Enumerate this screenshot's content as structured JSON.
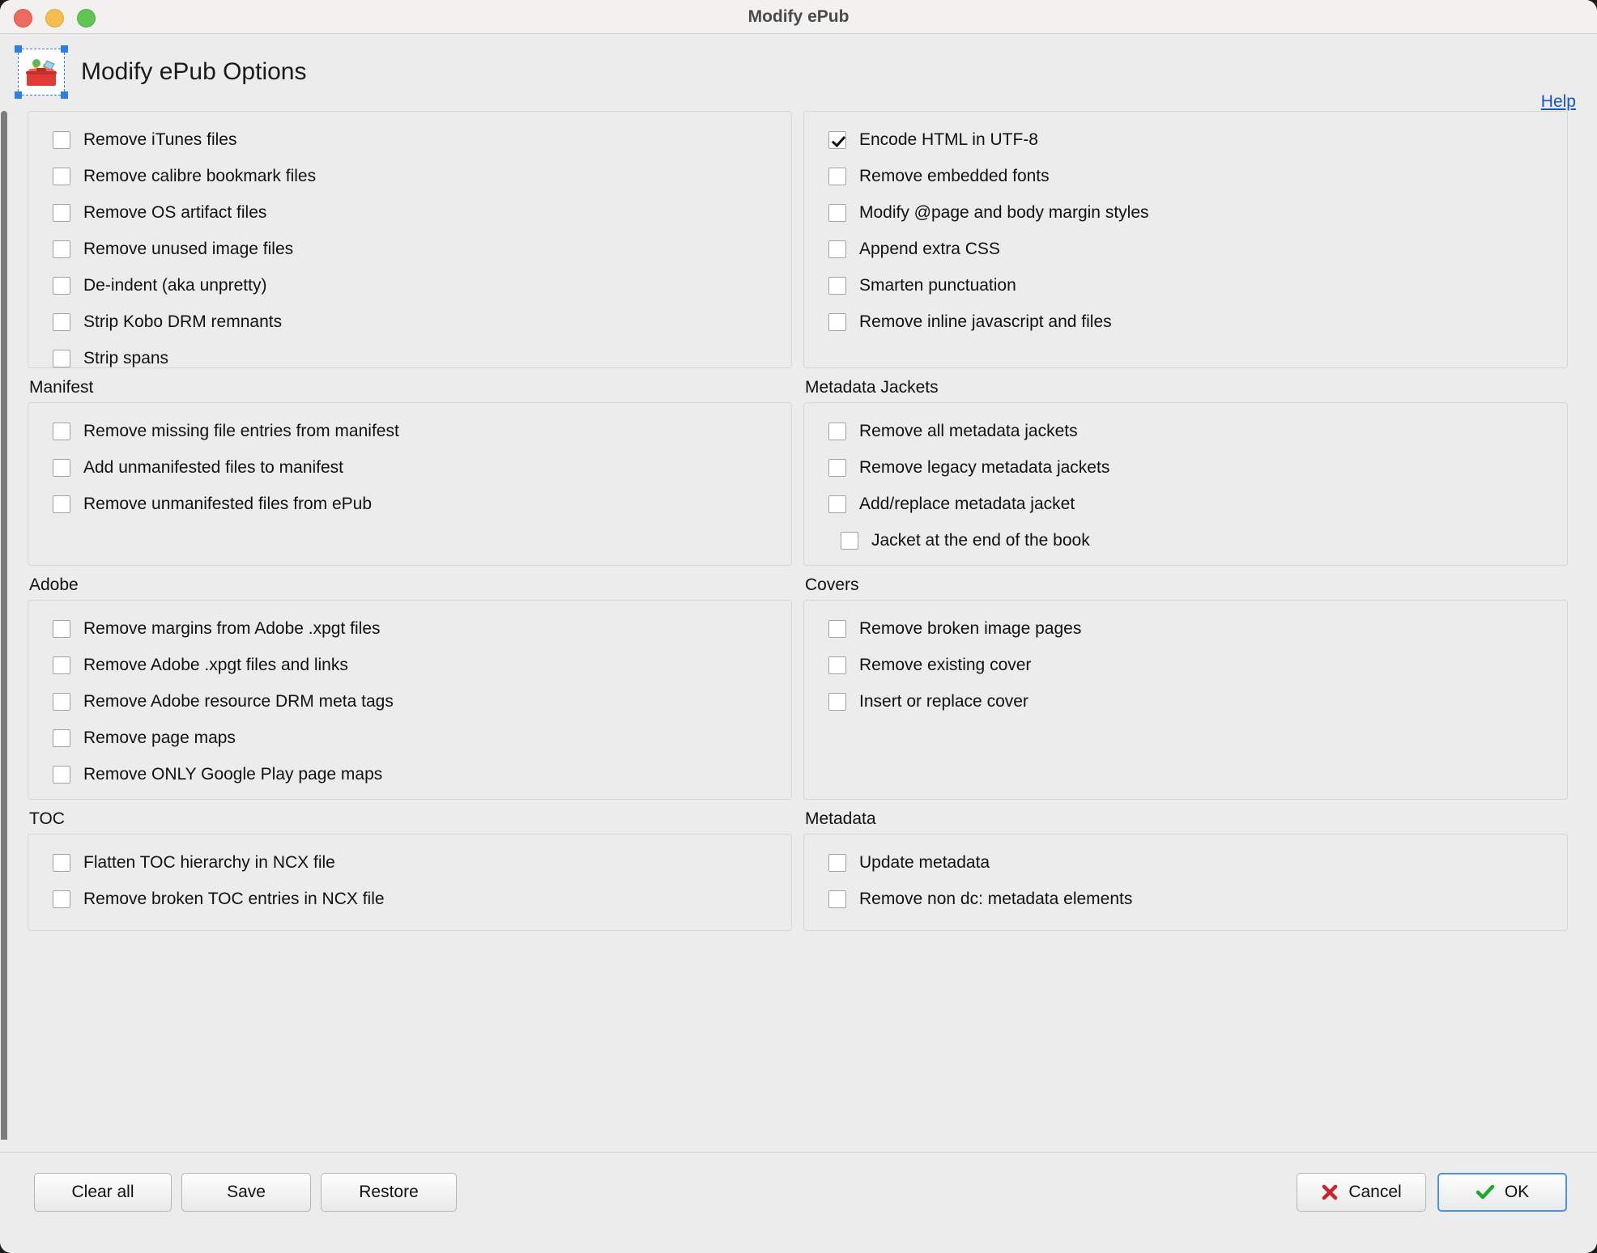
{
  "window": {
    "title": "Modify ePub",
    "traffic_lights": [
      "close",
      "minimize",
      "zoom"
    ]
  },
  "header": {
    "icon": "toolbox-icon",
    "title": "Modify ePub Options",
    "help_label": "Help"
  },
  "sections": [
    {
      "id": "files",
      "label": "",
      "column": "left",
      "options": [
        {
          "label": "Remove iTunes files",
          "checked": false
        },
        {
          "label": "Remove calibre bookmark files",
          "checked": false
        },
        {
          "label": "Remove OS artifact files",
          "checked": false
        },
        {
          "label": "Remove unused image files",
          "checked": false
        },
        {
          "label": "De-indent (aka unpretty)",
          "checked": false
        },
        {
          "label": "Strip Kobo DRM remnants",
          "checked": false
        },
        {
          "label": "Strip spans",
          "checked": false
        }
      ]
    },
    {
      "id": "html",
      "label": "",
      "column": "right",
      "options": [
        {
          "label": "Encode HTML in UTF-8",
          "checked": true
        },
        {
          "label": "Remove embedded fonts",
          "checked": false
        },
        {
          "label": "Modify @page and body margin styles",
          "checked": false
        },
        {
          "label": "Append extra CSS",
          "checked": false
        },
        {
          "label": "Smarten punctuation",
          "checked": false
        },
        {
          "label": "Remove inline javascript and files",
          "checked": false
        }
      ]
    },
    {
      "id": "manifest",
      "label": "Manifest",
      "column": "left",
      "options": [
        {
          "label": "Remove missing file entries from manifest",
          "checked": false
        },
        {
          "label": "Add unmanifested files to manifest",
          "checked": false
        },
        {
          "label": "Remove unmanifested files from ePub",
          "checked": false
        }
      ]
    },
    {
      "id": "jackets",
      "label": "Metadata Jackets",
      "column": "right",
      "options": [
        {
          "label": "Remove all metadata jackets",
          "checked": false
        },
        {
          "label": "Remove legacy metadata jackets",
          "checked": false
        },
        {
          "label": "Add/replace metadata jacket",
          "checked": false
        },
        {
          "label": "Jacket at the end of the book",
          "checked": false,
          "indent": true
        }
      ]
    },
    {
      "id": "adobe",
      "label": "Adobe",
      "column": "left",
      "options": [
        {
          "label": "Remove margins from Adobe .xpgt files",
          "checked": false
        },
        {
          "label": "Remove Adobe .xpgt files and links",
          "checked": false
        },
        {
          "label": "Remove Adobe resource DRM meta tags",
          "checked": false
        },
        {
          "label": "Remove page maps",
          "checked": false
        },
        {
          "label": "Remove ONLY Google Play page maps",
          "checked": false
        }
      ]
    },
    {
      "id": "covers",
      "label": "Covers",
      "column": "right",
      "options": [
        {
          "label": "Remove broken image pages",
          "checked": false
        },
        {
          "label": "Remove existing cover",
          "checked": false
        },
        {
          "label": "Insert or replace cover",
          "checked": false
        }
      ]
    },
    {
      "id": "toc",
      "label": "TOC",
      "column": "left",
      "options": [
        {
          "label": "Flatten TOC hierarchy in NCX file",
          "checked": false
        },
        {
          "label": "Remove broken TOC entries in NCX file",
          "checked": false
        }
      ]
    },
    {
      "id": "metadata",
      "label": "Metadata",
      "column": "right",
      "options": [
        {
          "label": "Update metadata",
          "checked": false
        },
        {
          "label": "Remove non dc: metadata elements",
          "checked": false
        }
      ]
    }
  ],
  "buttons": {
    "clear_all": "Clear all",
    "save": "Save",
    "restore": "Restore",
    "cancel": "Cancel",
    "ok": "OK"
  },
  "colors": {
    "link": "#1a54c4",
    "cancel_icon": "#c9252d",
    "ok_icon": "#1fa82c",
    "default_button_focus": "#4c93e8",
    "window_background": "#ececec",
    "titlebar_background": "#f2f1f0"
  }
}
